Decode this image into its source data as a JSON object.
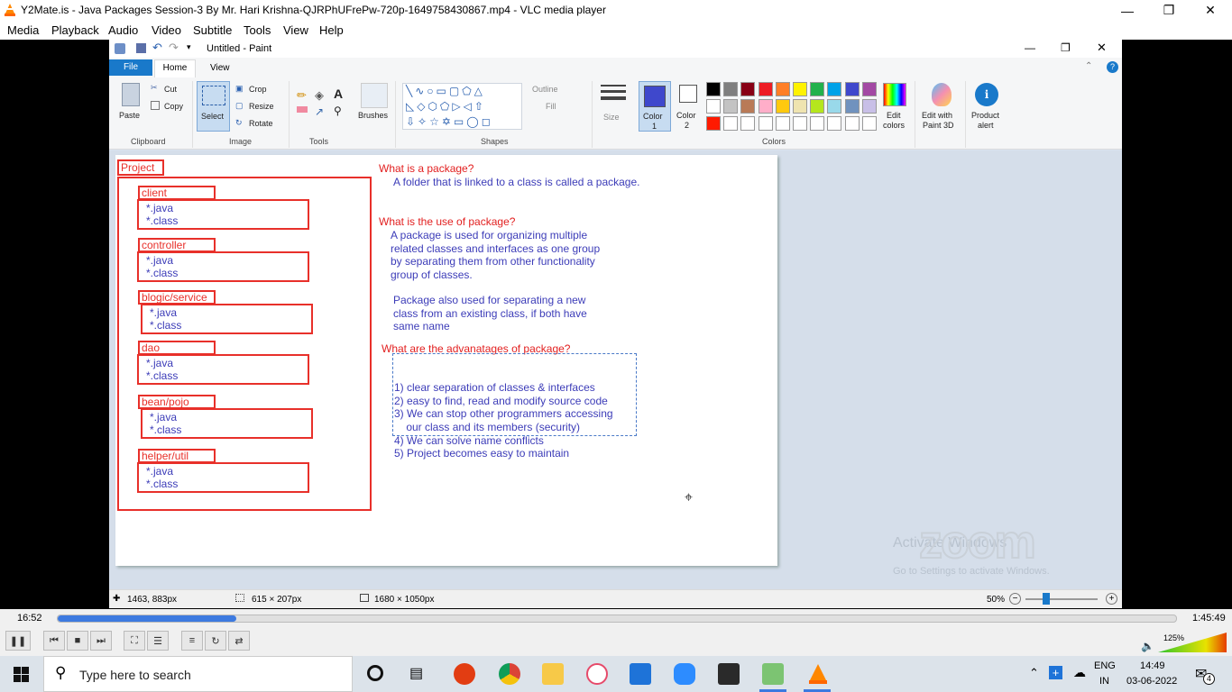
{
  "vlc": {
    "title": "Y2Mate.is - Java Packages Session-3  By Mr. Hari Krishna-QJRPhUFrePw-720p-1649758430867.mp4 - VLC media player",
    "menu": [
      "Media",
      "Playback",
      "Audio",
      "Video",
      "Subtitle",
      "Tools",
      "View",
      "Help"
    ],
    "time_elapsed": "16:52",
    "time_total": "1:45:49",
    "progress": 0.16,
    "volume_label": "125%"
  },
  "paint": {
    "title": "Untitled - Paint",
    "tabs": {
      "file": "File",
      "home": "Home",
      "view": "View"
    },
    "clipboard": {
      "paste": "Paste",
      "cut": "Cut",
      "copy": "Copy",
      "label": "Clipboard"
    },
    "image": {
      "select": "Select",
      "crop": "Crop",
      "resize": "Resize",
      "rotate": "Rotate",
      "label": "Image"
    },
    "tools": {
      "label": "Tools",
      "brushes": "Brushes"
    },
    "shapes": {
      "outline": "Outline",
      "fill": "Fill",
      "label": "Shapes"
    },
    "size": "Size",
    "color1": "Color\n1",
    "color1_a": "Color",
    "color1_b": "1",
    "color2_a": "Color",
    "color2_b": "2",
    "colors_label": "Colors",
    "edit_colors_a": "Edit",
    "edit_colors_b": "colors",
    "edit_3d_a": "Edit with",
    "edit_3d_b": "Paint 3D",
    "product_a": "Product",
    "product_b": "alert",
    "palette_row1": [
      "#000000",
      "#7f7f7f",
      "#880015",
      "#ed1c24",
      "#ff7f27",
      "#fff200",
      "#22b14c",
      "#00a2e8",
      "#3f48cc",
      "#a349a4"
    ],
    "palette_row2": [
      "#ffffff",
      "#c3c3c3",
      "#b97a57",
      "#ffaec9",
      "#ffc90e",
      "#efe4b0",
      "#b5e61d",
      "#99d9ea",
      "#7092be",
      "#c8bfe7"
    ],
    "palette_row3_first": "#ff1a00",
    "status": {
      "cursor": "1463, 883px",
      "selection": "615 × 207px",
      "size": "1680 × 1050px",
      "zoom": "50%"
    }
  },
  "canvas": {
    "project": "Project",
    "packages": [
      {
        "name": "client",
        "java": "*.java",
        "class": "*.class"
      },
      {
        "name": "controller",
        "java": "*.java",
        "class": "*.class"
      },
      {
        "name": "blogic/service",
        "java": "*.java",
        "class": "*.class"
      },
      {
        "name": "dao",
        "java": "*.java",
        "class": "*.class"
      },
      {
        "name": "bean/pojo",
        "java": "*.java",
        "class": "*.class"
      },
      {
        "name": "helper/util",
        "java": "*.java",
        "class": "*.class"
      }
    ],
    "q1": "What is a package?",
    "a1": "A folder that is linked to a class is called a package.",
    "q2": "What is the use of package?",
    "a2": [
      "A package is used for organizing multiple",
      "related classes and interfaces as one group",
      "by separating them from other functionality",
      "group of classes."
    ],
    "a2b": [
      "Package also used for separating a new",
      "class from an existing class, if both have",
      "same name"
    ],
    "q3": "What are the advanatages of package?",
    "a3": [
      "1) clear separation of classes & interfaces",
      "2) easy to find, read and modify source code",
      "3) We can stop other programmers accessing",
      "    our class and its members (security)",
      "4) We can solve name conflicts",
      "5) Project becomes easy to maintain"
    ],
    "watermark": "Activate Windows",
    "watermark_sub": "Go to Settings to activate Windows.",
    "zoom_logo": "zoom"
  },
  "taskbar": {
    "search_placeholder": "Type here to search",
    "lang1": "ENG",
    "lang2": "IN",
    "time": "14:49",
    "date": "03-06-2022",
    "notif_count": "4"
  }
}
